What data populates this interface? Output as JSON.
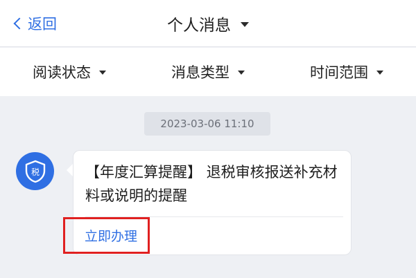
{
  "nav": {
    "back_label": "返回",
    "title": "个人消息"
  },
  "filters": [
    {
      "label": "阅读状态"
    },
    {
      "label": "消息类型"
    },
    {
      "label": "时间范围"
    }
  ],
  "message": {
    "timestamp": "2023-03-06 11:10",
    "avatar_glyph": "税",
    "text": "【年度汇算提醒】 退税审核报送补充材料或说明的提醒",
    "action_label": "立即办理"
  },
  "colors": {
    "accent": "#2f6fe3",
    "highlight_box": "#e02020",
    "background": "#eef0f4"
  },
  "icons": {
    "back": "chevron-left-icon",
    "dropdown": "caret-down-icon",
    "avatar": "tax-shield-icon"
  }
}
